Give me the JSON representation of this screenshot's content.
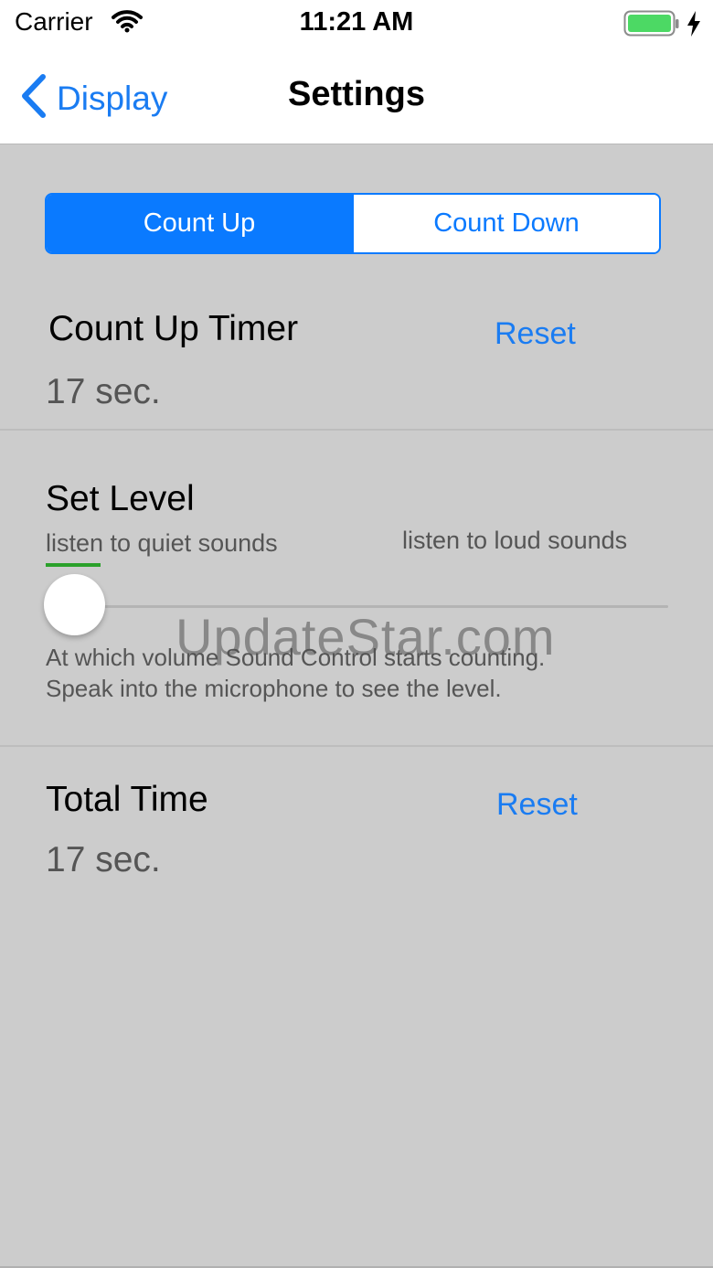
{
  "status": {
    "carrier": "Carrier",
    "time": "11:21 AM"
  },
  "nav": {
    "back_label": "Display",
    "title": "Settings"
  },
  "segments": {
    "count_up": "Count Up",
    "count_down": "Count Down",
    "selected": "Count Up"
  },
  "count_up_timer": {
    "label": "Count Up Timer",
    "value": "17 sec.",
    "reset_label": "Reset"
  },
  "level": {
    "label": "Set Level",
    "min_label": "listen to quiet sounds",
    "max_label": "listen to loud sounds",
    "slider_value": 0.0,
    "description_line1": "At which volume Sound Control starts counting.",
    "description_line2": "Speak into the microphone to see the level."
  },
  "total_time": {
    "label": "Total Time",
    "value": "17 sec.",
    "reset_label": "Reset"
  },
  "watermark": "UpdateStar.com",
  "colors": {
    "accent": "#0a7aff",
    "background": "#cccccc",
    "level_indicator": "#2aa12a"
  }
}
